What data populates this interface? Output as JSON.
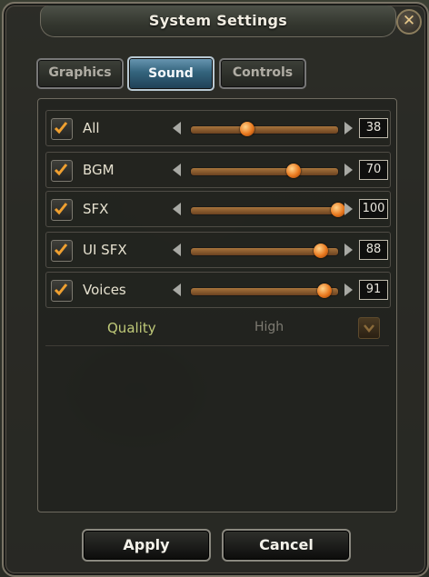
{
  "window": {
    "title": "System Settings",
    "close_icon": "close-icon"
  },
  "tabs": [
    {
      "label": "Graphics",
      "active": false
    },
    {
      "label": "Sound",
      "active": true
    },
    {
      "label": "Controls",
      "active": false
    }
  ],
  "sound_rows": [
    {
      "label": "All",
      "checked": true,
      "value": 38,
      "level": 0.38
    },
    {
      "label": "BGM",
      "checked": true,
      "value": 70,
      "level": 0.7
    },
    {
      "label": "SFX",
      "checked": true,
      "value": 100,
      "level": 1.0
    },
    {
      "label": "UI SFX",
      "checked": true,
      "value": 88,
      "level": 0.88
    },
    {
      "label": "Voices",
      "checked": true,
      "value": 91,
      "level": 0.91
    }
  ],
  "quality": {
    "label": "Quality",
    "value": "High"
  },
  "buttons": {
    "apply": "Apply",
    "cancel": "Cancel"
  },
  "colors": {
    "accent_orange": "#e8781e",
    "check_orange": "#f0a030",
    "tab_active": "#34647d"
  }
}
